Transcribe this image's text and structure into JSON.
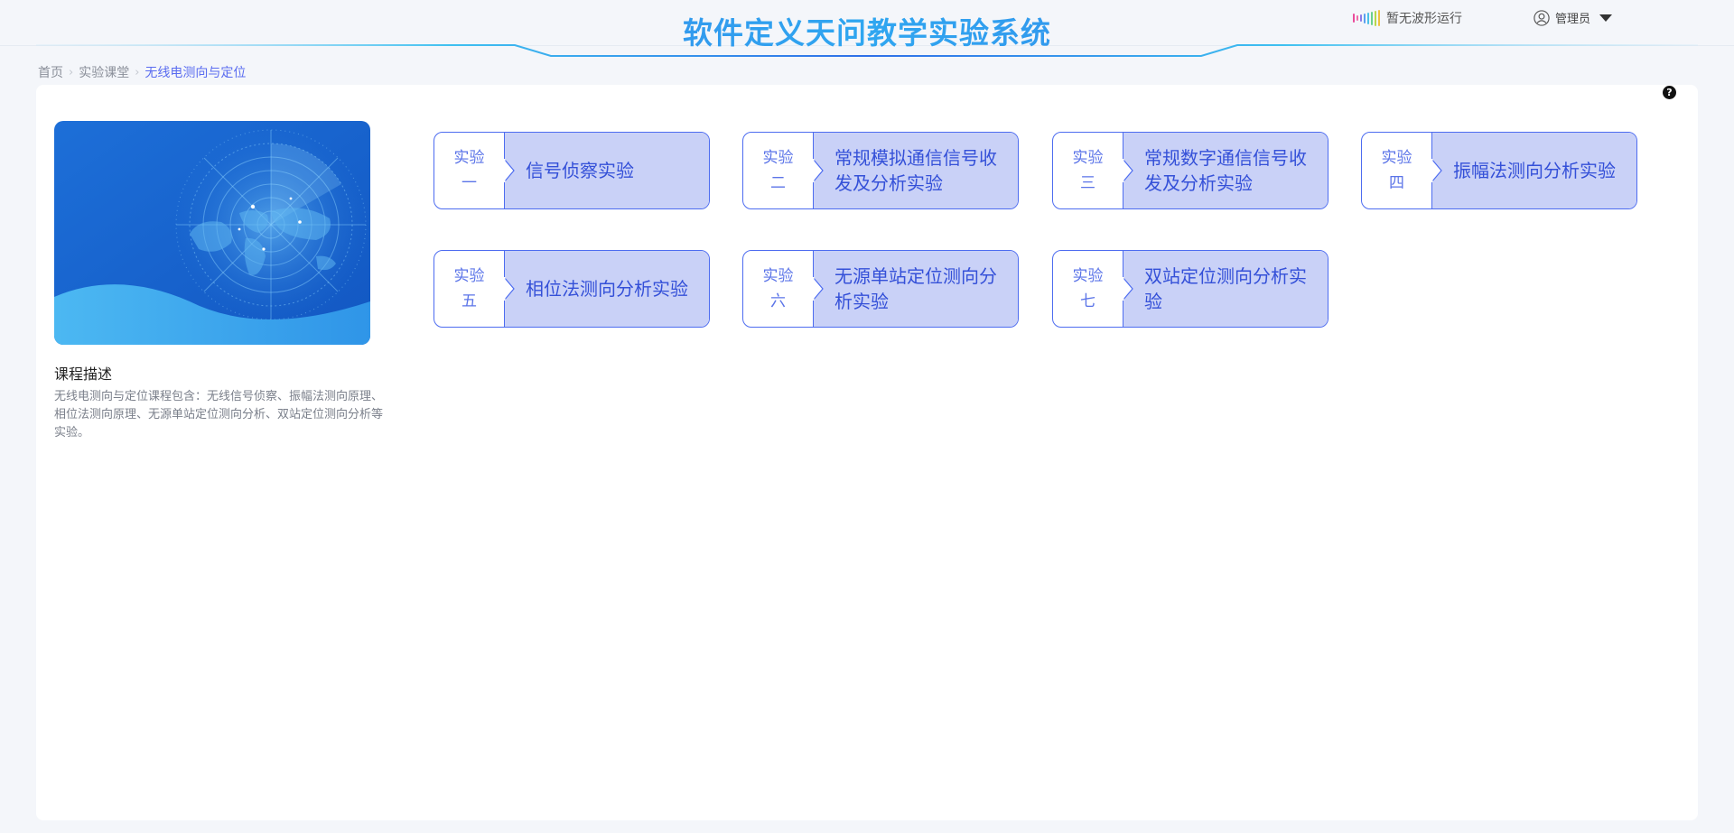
{
  "header": {
    "title": "软件定义天问教学实验系统",
    "wave_status": "暂无波形运行",
    "wave_icon": "waveform-icon",
    "user_name": "管理员",
    "user_icon": "user-icon",
    "dropdown_icon": "caret-down-icon"
  },
  "breadcrumb": {
    "items": [
      "首页",
      "实验课堂",
      "无线电测向与定位"
    ]
  },
  "course": {
    "description_title": "课程描述",
    "description": "无线电测向与定位课程包含：无线信号侦察、振幅法测向原理、相位法测向原理、无源单站定位测向分析、双站定位测向分析等实验。"
  },
  "help_icon": "question-icon",
  "experiments": [
    {
      "label": "实验",
      "num": "一",
      "name": "信号侦察实验"
    },
    {
      "label": "实验",
      "num": "二",
      "name": "常规模拟通信信号收发及分析实验"
    },
    {
      "label": "实验",
      "num": "三",
      "name": "常规数字通信信号收发及分析实验"
    },
    {
      "label": "实验",
      "num": "四",
      "name": "振幅法测向分析实验"
    },
    {
      "label": "实验",
      "num": "五",
      "name": "相位法测向分析实验"
    },
    {
      "label": "实验",
      "num": "六",
      "name": "无源单站定位测向分析实验"
    },
    {
      "label": "实验",
      "num": "七",
      "name": "双站定位测向分析实验"
    }
  ],
  "colors": {
    "accent": "#4d6cf0",
    "card_fill": "#c9d1f7",
    "title_blue": "#2f7ff0",
    "breadcrumb_current": "#5a6cf0"
  }
}
